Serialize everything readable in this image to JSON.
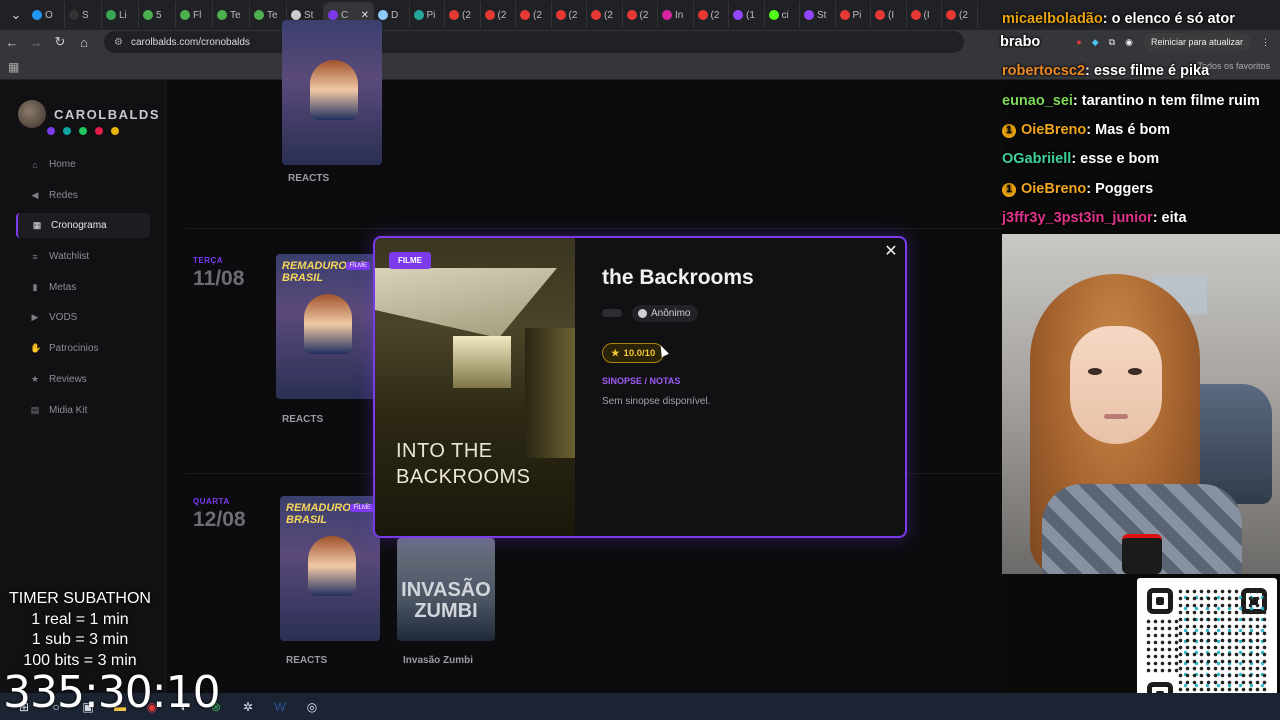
{
  "browser": {
    "active_tab": {
      "label": "C"
    },
    "tabs": [
      {
        "label": "O",
        "color": "#2196f3"
      },
      {
        "label": "S",
        "color": "#333333"
      },
      {
        "label": "Li",
        "color": "#3aa757"
      },
      {
        "label": "5",
        "color": "#4caf50"
      },
      {
        "label": "Fl",
        "color": "#4caf50"
      },
      {
        "label": "Te",
        "color": "#4caf50"
      },
      {
        "label": "Te",
        "color": "#4caf50"
      },
      {
        "label": "St",
        "color": "#cccccc"
      }
    ],
    "right_tabs": [
      {
        "label": "D",
        "color": "#90caf9"
      },
      {
        "label": "Pi",
        "color": "#26a69a"
      },
      {
        "label": "(2",
        "color": "#e53935"
      },
      {
        "label": "(2",
        "color": "#e53935"
      },
      {
        "label": "(2",
        "color": "#e53935"
      },
      {
        "label": "(2",
        "color": "#e53935"
      },
      {
        "label": "(2",
        "color": "#e53935"
      },
      {
        "label": "(2",
        "color": "#e53935"
      },
      {
        "label": "In",
        "color": "#d6249f"
      },
      {
        "label": "(2",
        "color": "#e53935"
      },
      {
        "label": "(1",
        "color": "#9146ff"
      },
      {
        "label": "ci",
        "color": "#53fc18"
      },
      {
        "label": "St",
        "color": "#9146ff"
      },
      {
        "label": "Pi",
        "color": "#e53935"
      },
      {
        "label": "(I",
        "color": "#e53935"
      },
      {
        "label": "(I",
        "color": "#e53935"
      },
      {
        "label": "(2",
        "color": "#e53935"
      }
    ],
    "url": "carolbalds.com/cronobalds",
    "update_button": "Reiniciar para atualizar",
    "favorites_label": "Todos os favoritos"
  },
  "site": {
    "logo_text": "CAROLBALDS",
    "logo_dot_colors": [
      "#7c3aed",
      "#0ea5a4",
      "#22c55e",
      "#e11d48",
      "#eab308"
    ],
    "menu": [
      {
        "label": "Home",
        "icon": "home-icon",
        "glyph": "⌂",
        "active": false
      },
      {
        "label": "Redes",
        "icon": "megaphone-icon",
        "glyph": "◀",
        "active": false
      },
      {
        "label": "Cronograma",
        "icon": "calendar-icon",
        "glyph": "▦",
        "active": true
      },
      {
        "label": "Watchlist",
        "icon": "list-icon",
        "glyph": "≡",
        "active": false
      },
      {
        "label": "Metas",
        "icon": "chart-icon",
        "glyph": "▮",
        "active": false
      },
      {
        "label": "VODS",
        "icon": "play-circle-icon",
        "glyph": "▶",
        "active": false
      },
      {
        "label": "Patrocinios",
        "icon": "handshake-icon",
        "glyph": "✋",
        "active": false
      },
      {
        "label": "Reviews",
        "icon": "star-icon",
        "glyph": "★",
        "active": false
      },
      {
        "label": "Midia Kit",
        "icon": "id-card-icon",
        "glyph": "▤",
        "active": false
      }
    ]
  },
  "schedule": [
    {
      "day": "",
      "date": "",
      "cards": [
        {
          "label": "REACTS"
        }
      ]
    },
    {
      "day": "TERÇA",
      "date": "11/08",
      "cards": [
        {
          "label": "REACTS",
          "badge": "FILME",
          "poster_title": "REMADURO DO BRASIL"
        }
      ]
    },
    {
      "day": "QUARTA",
      "date": "12/08",
      "cards": [
        {
          "label": "REACTS",
          "badge": "FILME",
          "poster_title": "REMADURO DO BRASIL"
        },
        {
          "label": "Invasão Zumbi",
          "poster_title": "INVASÃO ZUMBI"
        }
      ]
    }
  ],
  "modal": {
    "badge": "FILME",
    "poster_text_line1": "INTO THE",
    "poster_text_line2": "BACKROOMS",
    "title": "the Backrooms",
    "author": "Anônimo",
    "rating": "10.0/10",
    "section_label": "SINOPSE / NOTAS",
    "synopsis": "Sem sinopse disponível.",
    "close_glyph": "✕"
  },
  "chat": [
    {
      "user": "micaelboladão",
      "message": ": o elenco é só ator",
      "color": "#e8a30f",
      "badge": false
    },
    {
      "user": "",
      "message": "brabo",
      "color": "#ffffff",
      "badge": false
    },
    {
      "user": "robertocsc2",
      "message": ": esse filme é pika",
      "color": "#f08a24",
      "badge": false
    },
    {
      "user": "eunao_sei",
      "message": ": tarantino n tem filme ruim",
      "color": "#7fd858",
      "badge": false
    },
    {
      "user": "OieBreno",
      "message": ": Mas é bom",
      "color": "#f0a520",
      "badge": true
    },
    {
      "user": "OGabriiell",
      "message": ": esse e bom",
      "color": "#3fd29a",
      "badge": false
    },
    {
      "user": "OieBreno",
      "message": ": Poggers",
      "color": "#f0a520",
      "badge": true
    },
    {
      "user": "j3ffr3y_3pst3in_junior",
      "message": ": eita",
      "color": "#e0338c",
      "badge": false
    }
  ],
  "subathon": {
    "title": "TIMER SUBATHON",
    "rule1": "1 real = 1 min",
    "rule2": "1 sub = 3 min",
    "rule3": "100 bits = 3 min",
    "timer": "335:30:10"
  },
  "taskbar": {
    "icons": [
      "start-icon",
      "search-icon",
      "task-view-icon",
      "file-explorer-icon",
      "chrome-icon",
      "discord-icon",
      "xbox-icon",
      "settings-icon",
      "word-icon",
      "obs-icon"
    ]
  },
  "colors": {
    "accent": "#7c3aed",
    "rating": "#f3c634"
  }
}
